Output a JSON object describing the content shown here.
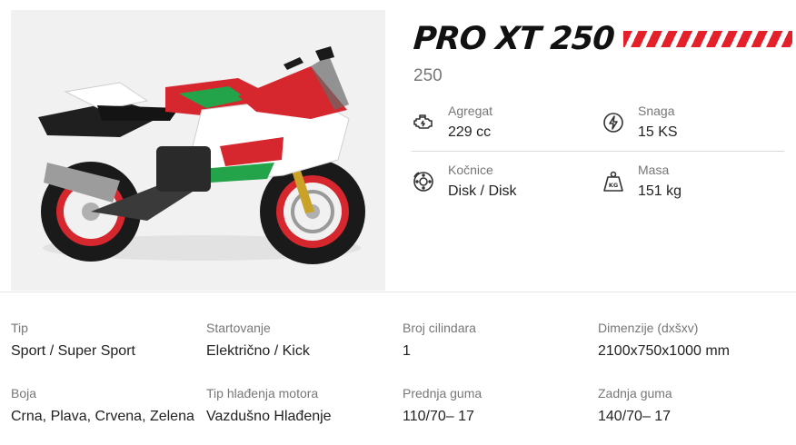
{
  "product": {
    "title": "PRO XT 250",
    "subtitle": "250",
    "accent_color": "#e4202b",
    "image_alt": "motorcycle-photo"
  },
  "key_specs": [
    {
      "label": "Agregat",
      "value": "229 cc",
      "icon": "engine-icon"
    },
    {
      "label": "Snaga",
      "value": "15 KS",
      "icon": "power-icon"
    },
    {
      "label": "Kočnice",
      "value": "Disk / Disk",
      "icon": "brake-disc-icon"
    },
    {
      "label": "Masa",
      "value": "151 kg",
      "icon": "weight-icon",
      "icon_text": "KG"
    }
  ],
  "details": [
    {
      "label": "Tip",
      "value": "Sport / Super Sport"
    },
    {
      "label": "Startovanje",
      "value": "Električno / Kick"
    },
    {
      "label": "Broj cilindara",
      "value": "1"
    },
    {
      "label": "Dimenzije (dxšxv)",
      "value": "2100x750x1000 mm"
    },
    {
      "label": "Boja",
      "value": "Crna, Plava, Crvena, Zelena"
    },
    {
      "label": "Tip hlađenja motora",
      "value": "Vazdušno Hlađenje"
    },
    {
      "label": "Prednja guma",
      "value": "110/70– 17"
    },
    {
      "label": "Zadnja guma",
      "value": "140/70– 17"
    }
  ]
}
